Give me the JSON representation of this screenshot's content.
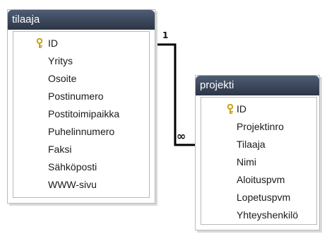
{
  "tables": [
    {
      "title": "tilaaja",
      "fields": [
        {
          "name": "ID",
          "key": true
        },
        {
          "name": "Yritys",
          "key": false
        },
        {
          "name": "Osoite",
          "key": false
        },
        {
          "name": "Postinumero",
          "key": false
        },
        {
          "name": "Postitoimipaikka",
          "key": false
        },
        {
          "name": "Puhelinnumero",
          "key": false
        },
        {
          "name": "Faksi",
          "key": false
        },
        {
          "name": "Sähköposti",
          "key": false
        },
        {
          "name": "WWW-sivu",
          "key": false
        }
      ]
    },
    {
      "title": "projekti",
      "fields": [
        {
          "name": "ID",
          "key": true
        },
        {
          "name": "Projektinro",
          "key": false
        },
        {
          "name": "Tilaaja",
          "key": false
        },
        {
          "name": "Nimi",
          "key": false
        },
        {
          "name": "Aloituspvm",
          "key": false
        },
        {
          "name": "Lopetuspvm",
          "key": false
        },
        {
          "name": "Yhteyshenkilö",
          "key": false
        }
      ]
    }
  ],
  "relationship": {
    "one_label": "1",
    "many_label": "∞"
  },
  "colors": {
    "titlebar": "#3b475b",
    "border": "#b9b9b9",
    "key_icon": "#c9a21a"
  },
  "icons": {
    "primary_key": "key-icon"
  }
}
